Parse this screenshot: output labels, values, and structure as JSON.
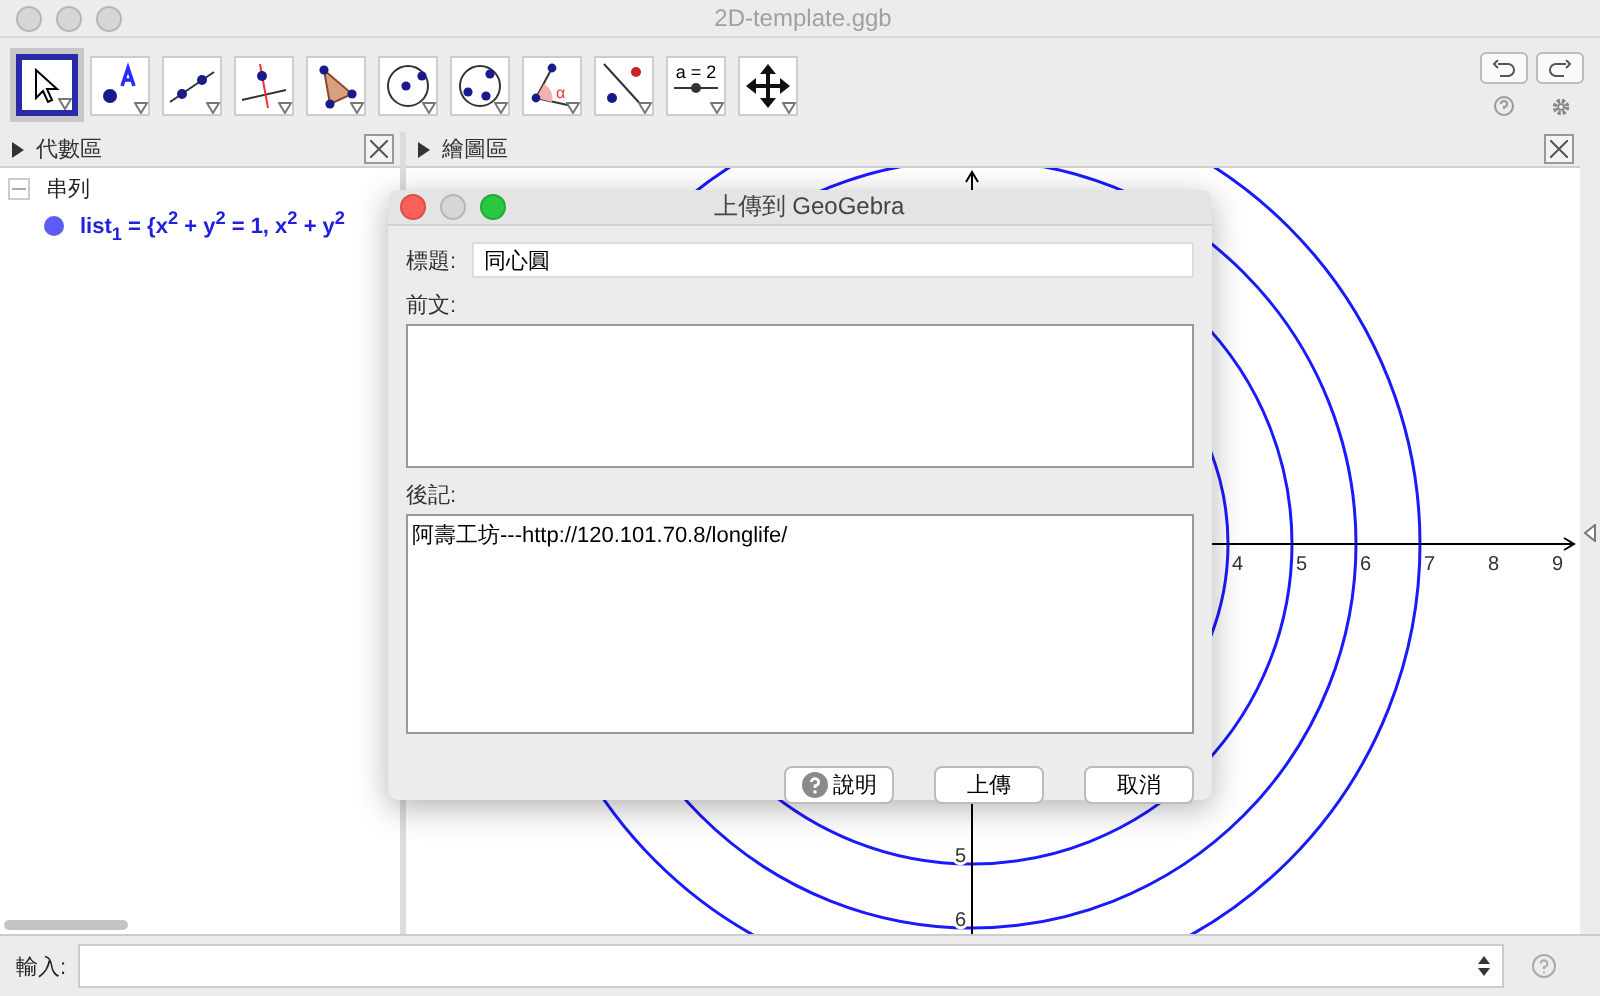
{
  "window": {
    "title": "2D-template.ggb"
  },
  "toolbar": {
    "tools": [
      {
        "kind": "move",
        "selected": true
      },
      {
        "kind": "point",
        "selected": false
      },
      {
        "kind": "line",
        "selected": false
      },
      {
        "kind": "perpendicular",
        "selected": false
      },
      {
        "kind": "polygon",
        "selected": false
      },
      {
        "kind": "circle",
        "selected": false
      },
      {
        "kind": "conic",
        "selected": false
      },
      {
        "kind": "angle",
        "selected": false,
        "label": "α"
      },
      {
        "kind": "reflect",
        "selected": false
      },
      {
        "kind": "slider",
        "selected": false,
        "label": "a = 2"
      },
      {
        "kind": "pan",
        "selected": false
      }
    ]
  },
  "algebra_panel": {
    "title": "代數區",
    "groups": [
      {
        "name": "串列",
        "expanded": true,
        "items": [
          {
            "text": "list$_{1}$ = {x$^{2}$ + y$^{2}$ = 1, x$^{2}$ + y$^{2}$",
            "color": "#5b5bf5"
          }
        ]
      }
    ]
  },
  "graphics_panel": {
    "title": "繪圖區",
    "x_axis_labels": [
      "4",
      "5",
      "6",
      "7",
      "8",
      "9"
    ],
    "y_axis_labels": [
      "5",
      "6"
    ]
  },
  "dialog": {
    "title": "上傳到 GeoGebra",
    "title_field": {
      "label": "標題:",
      "value": "同心圓"
    },
    "preface": {
      "label": "前文:"
    },
    "afterword": {
      "label": "後記:",
      "value": "阿壽工坊---http://120.101.70.8/longlife/"
    },
    "buttons": [
      {
        "kind": "help",
        "label": "說明"
      },
      {
        "kind": "plain",
        "label": "上傳"
      },
      {
        "kind": "plain",
        "label": "取消"
      }
    ]
  },
  "input_bar": {
    "label": "輸入:"
  }
}
